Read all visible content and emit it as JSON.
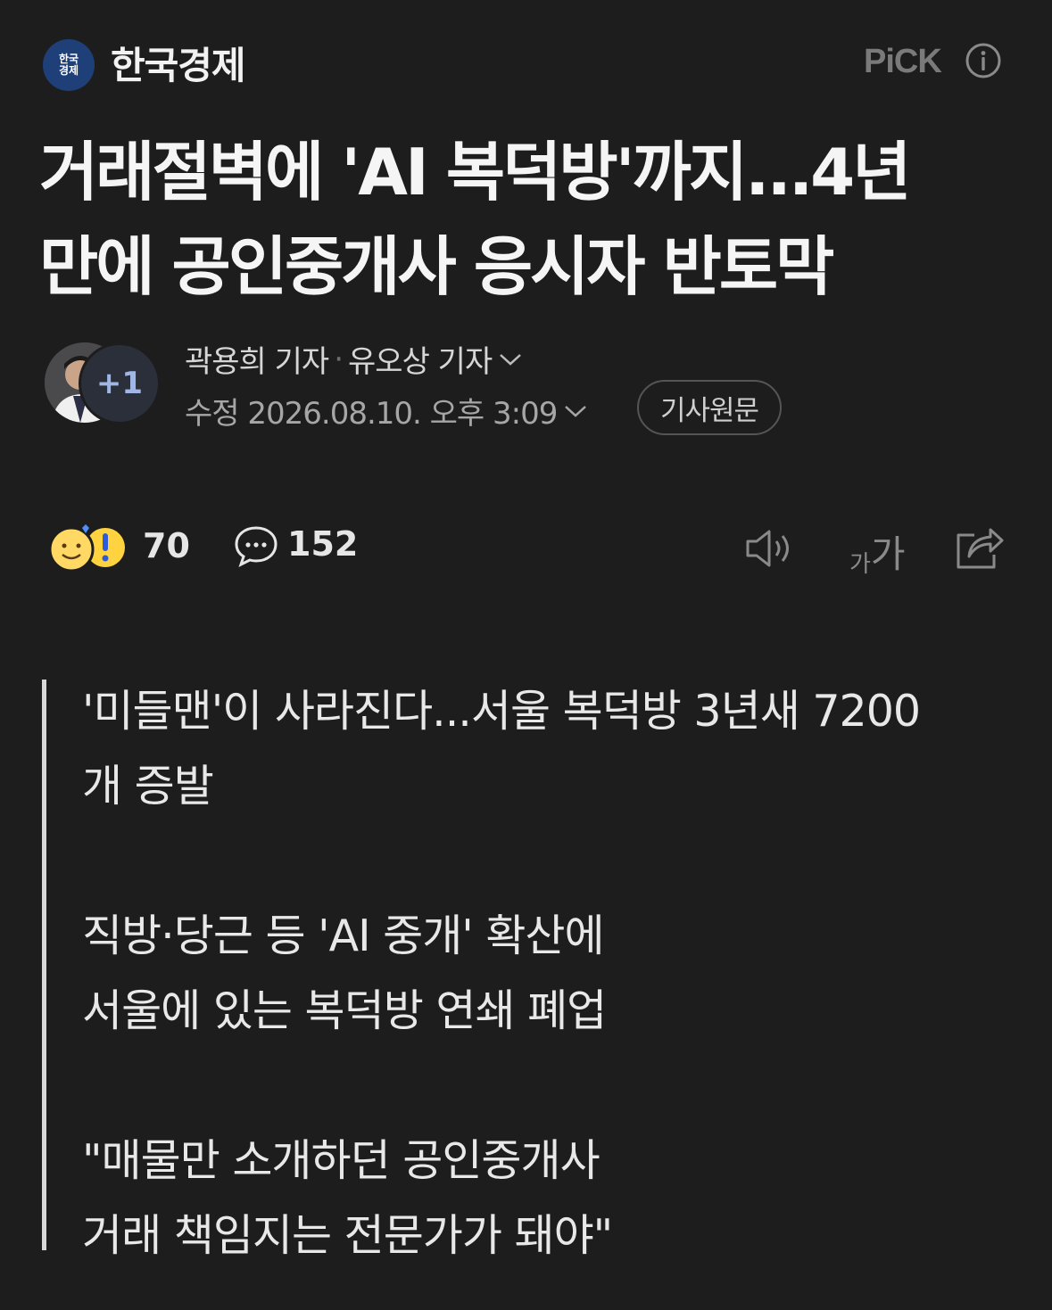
{
  "header": {
    "press_logo_text": "한국경제",
    "press_name": "한국경제",
    "pick_label": "PiCK"
  },
  "article": {
    "headline_line1": "거래절벽에 'AI 복덕방'까지...4년",
    "headline_line2": "만에 공인중개사 응시자 반토막",
    "reporters": [
      "곽용희 기자",
      "유오상 기자"
    ],
    "reporter_more": "+1",
    "date_label": "수정 2026.08.10. 오후 3:09",
    "original_button": "기사원문"
  },
  "actions": {
    "reaction_count": "70",
    "comment_count": "152",
    "font_small": "가",
    "font_large": "가"
  },
  "summary": [
    "'미들맨'이 사라진다...서울 복덕방 3년새 7200",
    "개 증발",
    "직방·당근 등 'AI 중개' 확산에",
    "서울에 있는 복덕방 연쇄 폐업",
    "\"매물만 소개하던 공인중개사",
    "거래 책임지는 전문가가 돼야\""
  ],
  "colors": {
    "background": "#1d1d1e",
    "press_logo": "#1e3f78",
    "plus_text": "#9fb6e6",
    "muted": "#8a8a8a"
  },
  "icons": [
    "info-icon",
    "chevron-down-icon",
    "reaction-emoji-icon",
    "comment-icon",
    "speaker-icon",
    "share-icon"
  ]
}
